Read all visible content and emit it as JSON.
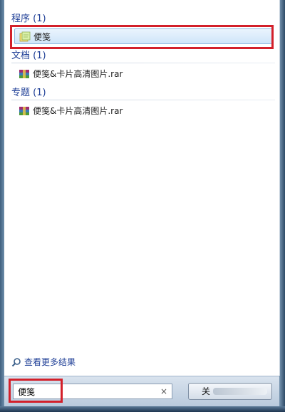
{
  "groups": [
    {
      "title": "程序 (1)",
      "items": [
        {
          "label": "便笺",
          "icon": "sticky-notes-icon",
          "selected": true
        }
      ]
    },
    {
      "title": "文档 (1)",
      "items": [
        {
          "label": "便笺&卡片高清图片.rar",
          "icon": "rar-archive-icon"
        }
      ]
    },
    {
      "title": "专题 (1)",
      "items": [
        {
          "label": "便笺&卡片高清图片.rar",
          "icon": "rar-archive-icon"
        }
      ]
    }
  ],
  "more_results": {
    "label": "查看更多结果",
    "icon": "search-icon"
  },
  "search": {
    "value": "便笺",
    "clear": "×"
  },
  "shutdown": {
    "label": "关"
  },
  "colors": {
    "group_header": "#1e3e96",
    "highlight": "#d3202a",
    "selection": "#cfe5f9"
  }
}
